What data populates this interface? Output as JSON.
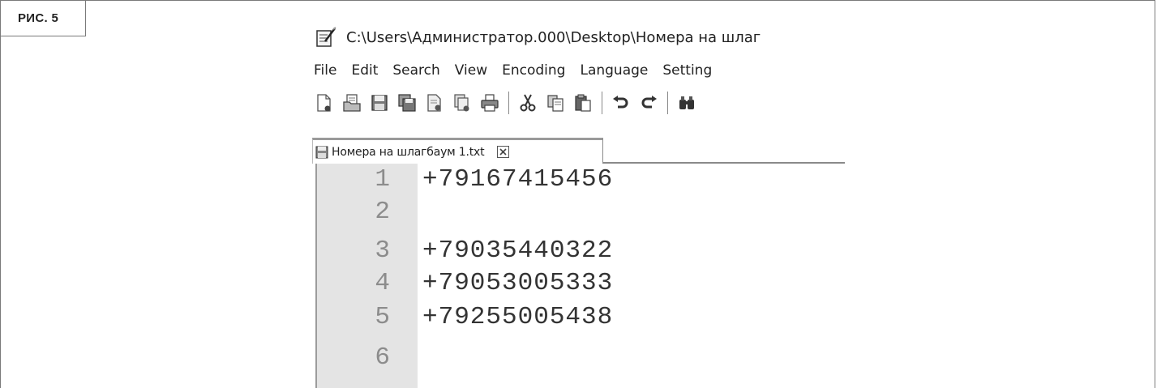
{
  "figure_label": "РИС. 5",
  "window": {
    "title": "C:\\Users\\Администратор.000\\Desktop\\Номера на шлаг"
  },
  "menu": [
    {
      "label": "File"
    },
    {
      "label": "Edit"
    },
    {
      "label": "Search"
    },
    {
      "label": "View"
    },
    {
      "label": "Encoding"
    },
    {
      "label": "Language"
    },
    {
      "label": "Setting"
    }
  ],
  "toolbar_icons": [
    "new-file-icon",
    "open-file-icon",
    "save-icon",
    "save-all-icon",
    "close-icon",
    "close-all-icon",
    "print-icon",
    "cut-icon",
    "copy-icon",
    "paste-icon",
    "undo-icon",
    "redo-icon",
    "find-icon"
  ],
  "tab": {
    "label": "Номера на шлагбаум 1.txt"
  },
  "editor": {
    "lines": [
      {
        "number": "1",
        "text": "+79167415456"
      },
      {
        "number": "2",
        "text": ""
      },
      {
        "number": "3",
        "text": "+79035440322"
      },
      {
        "number": "4",
        "text": "+79053005333"
      },
      {
        "number": "5",
        "text": "+79255005438"
      },
      {
        "number": "6",
        "text": ""
      }
    ]
  }
}
